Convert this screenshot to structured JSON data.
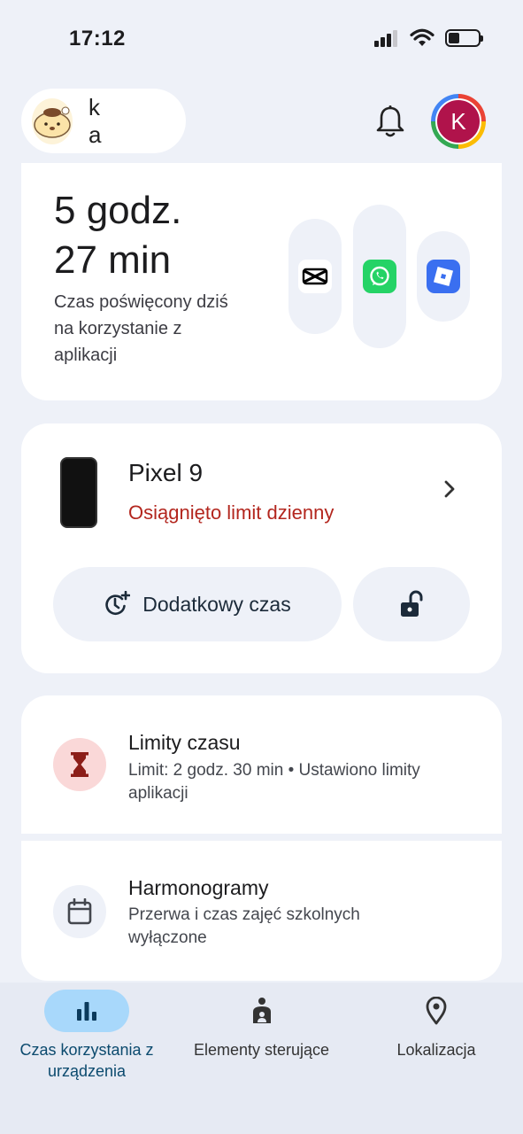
{
  "status_bar": {
    "time": "17:12"
  },
  "header": {
    "profile_name": "k a",
    "avatar_letter": "K"
  },
  "usage": {
    "hours": "5 godz.",
    "minutes": "27 min",
    "caption": "Czas poświęcony dziś na korzystanie z aplikacji",
    "apps": [
      {
        "icon": "capcut-icon",
        "color": "#000000"
      },
      {
        "icon": "whatsapp-icon",
        "color": "#25d366"
      },
      {
        "icon": "roblox-icon",
        "color": "#3a6ff0"
      }
    ]
  },
  "device": {
    "name": "Pixel 9",
    "status": "Osiągnięto limit dzienny",
    "status_color": "#b3261e",
    "extra_time_label": "Dodatkowy czas"
  },
  "limits": {
    "title": "Limity czasu",
    "subtitle": "Limit: 2 godz. 30 min • Ustawiono limity aplikacji"
  },
  "schedules": {
    "title": "Harmonogramy",
    "subtitle": "Przerwa i czas zajęć szkolnych wyłączone"
  },
  "nav": {
    "items": [
      {
        "label": "Czas korzystania z urządzenia",
        "icon": "bar-chart-icon",
        "active": true
      },
      {
        "label": "Elementy sterujące",
        "icon": "family-controls-icon",
        "active": false
      },
      {
        "label": "Lokalizacja",
        "icon": "location-pin-icon",
        "active": false
      }
    ]
  },
  "colors": {
    "accent": "#a8d8fb",
    "background": "#eef1f8"
  }
}
